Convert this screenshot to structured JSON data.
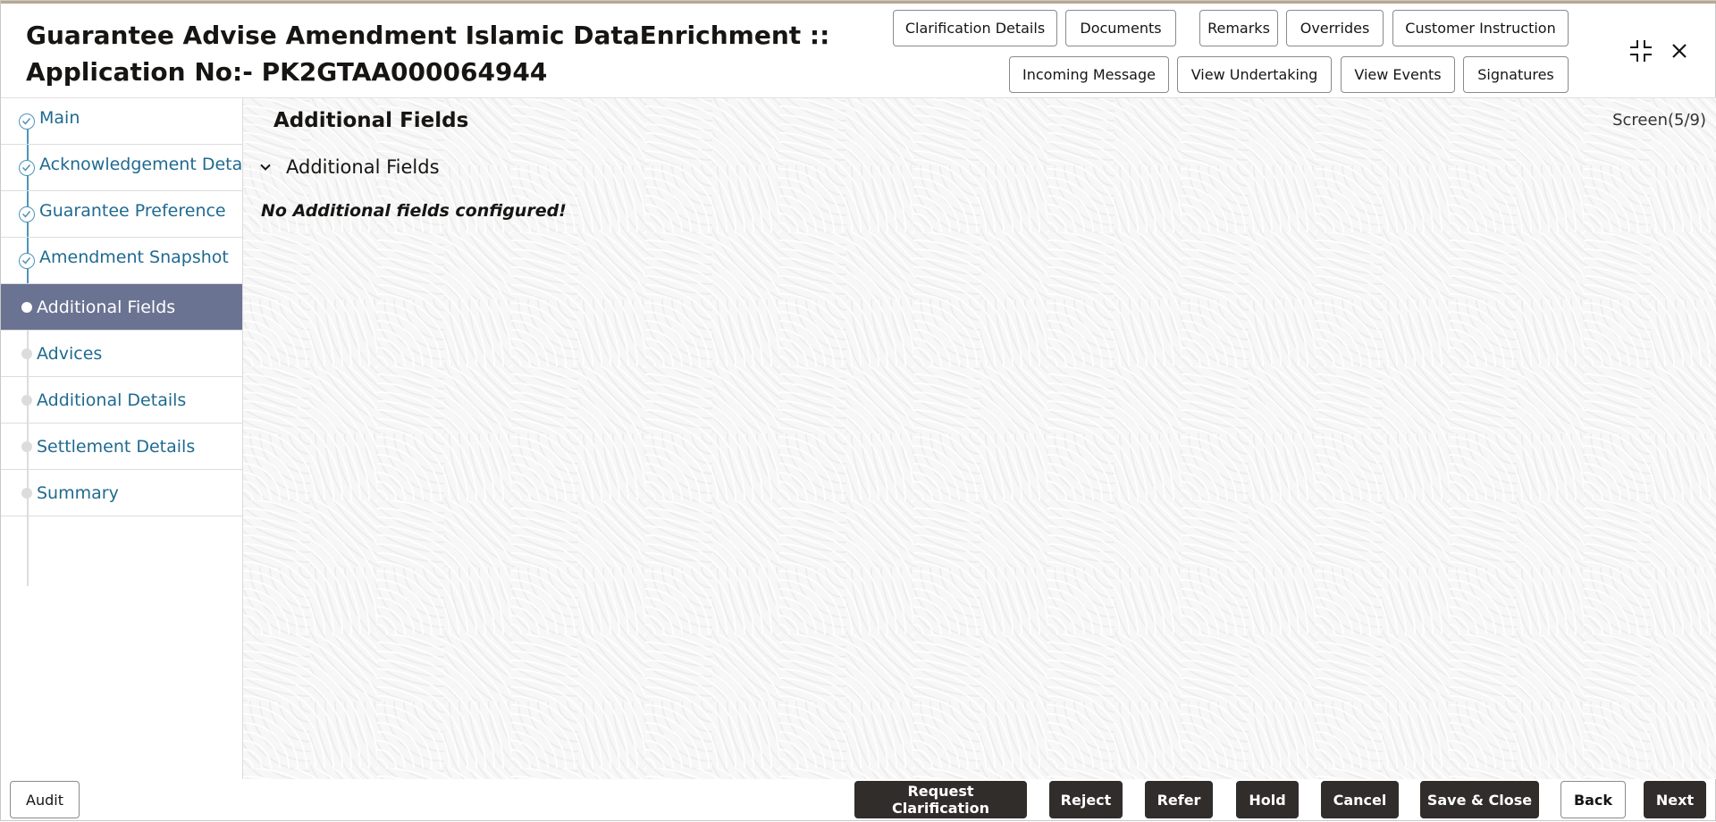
{
  "header": {
    "title_line1": "Guarantee Advise Amendment Islamic DataEnrichment ::",
    "title_line2": "Application No:- PK2GTAA000064944",
    "buttons_row1": [
      "Clarification Details",
      "Documents",
      "Remarks",
      "Overrides",
      "Customer Instruction"
    ],
    "buttons_row2": [
      "Incoming Message",
      "View Undertaking",
      "View Events",
      "Signatures"
    ],
    "icons": {
      "collapse": "collapse-icon",
      "close": "close-icon"
    }
  },
  "sidebar": {
    "steps": [
      {
        "label": "Main",
        "state": "complete"
      },
      {
        "label": "Acknowledgement Details",
        "state": "complete"
      },
      {
        "label": "Guarantee Preference",
        "state": "complete"
      },
      {
        "label": "Amendment Snapshot",
        "state": "complete"
      },
      {
        "label": "Additional Fields",
        "state": "active"
      },
      {
        "label": "Advices",
        "state": "pending"
      },
      {
        "label": "Additional Details",
        "state": "pending"
      },
      {
        "label": "Settlement Details",
        "state": "pending"
      },
      {
        "label": "Summary",
        "state": "pending"
      }
    ]
  },
  "main": {
    "page_title": "Additional Fields",
    "screen_indicator": "Screen(5/9)",
    "section_title": "Additional Fields",
    "empty_message": "No Additional fields configured!"
  },
  "footer": {
    "audit": "Audit",
    "buttons": [
      "Request Clarification",
      "Reject",
      "Refer",
      "Hold",
      "Cancel",
      "Save & Close",
      "Back",
      "Next"
    ]
  },
  "colors": {
    "link": "#1f6a8f",
    "active_step_bg": "#6b7393",
    "primary_button": "#312d2a",
    "step_line": "#4c94b8"
  }
}
